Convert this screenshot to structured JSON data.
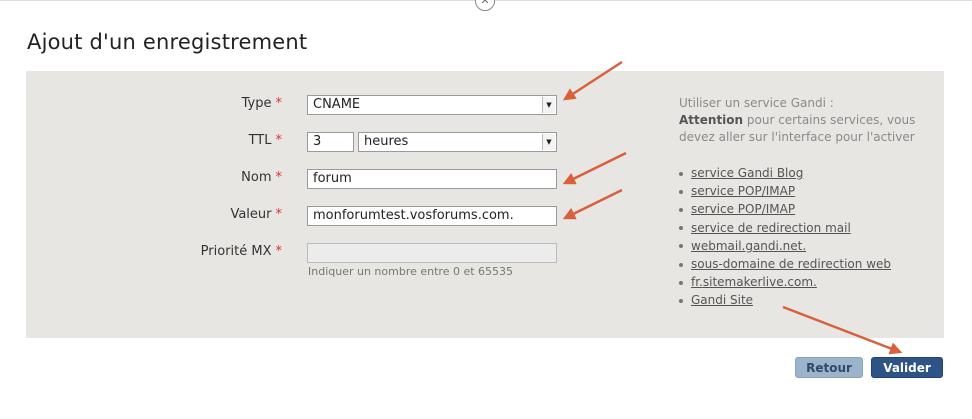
{
  "dialog": {
    "title": "Ajout d'un enregistrement",
    "close_glyph": "✕"
  },
  "form": {
    "required_mark": "*",
    "type_label": "Type",
    "type_value": "CNAME",
    "ttl_label": "TTL",
    "ttl_value": "3",
    "ttl_unit_value": "heures",
    "nom_label": "Nom",
    "nom_value": "forum",
    "valeur_label": "Valeur",
    "valeur_value": "monforumtest.vosforums.com.",
    "priorite_label": "Priorité MX",
    "priorite_value": "",
    "priorite_hint": "Indiquer un nombre entre 0 et 65535"
  },
  "sidebar": {
    "intro": "Utiliser un service Gandi :",
    "attention": "Attention",
    "attention_text": " pour certains services, vous devez aller sur l'interface pour l'activer",
    "links": [
      "service Gandi Blog",
      "service POP/IMAP",
      "service POP/IMAP",
      "service de redirection mail",
      "webmail.gandi.net.",
      "sous-domaine de redirection web",
      "fr.sitemakerlive.com.",
      "Gandi Site"
    ]
  },
  "buttons": {
    "back": "Retour",
    "submit": "Valider"
  },
  "colors": {
    "panel": "#e7e6e3",
    "required": "#d9342b",
    "annotation_arrow": "#d9603b",
    "primary_button": "#2e5486",
    "secondary_button": "#9bb4cc"
  }
}
